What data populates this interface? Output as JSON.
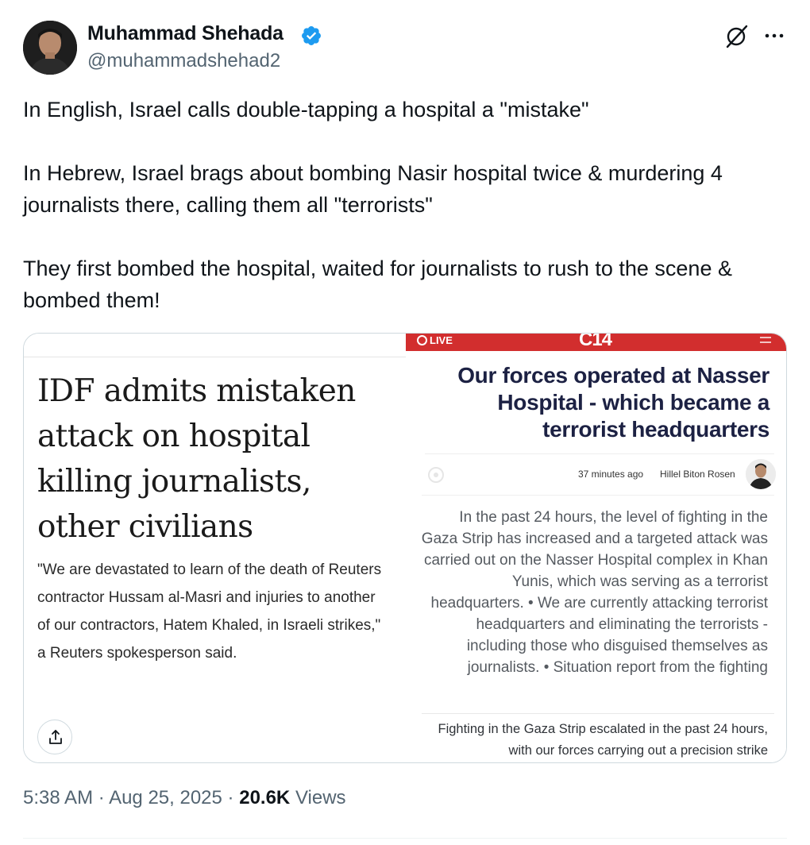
{
  "author": {
    "display_name": "Muhammad Shehada",
    "handle": "@muhammadshehad2",
    "verified": true,
    "avatar_icon": "person-portrait"
  },
  "header_actions": {
    "grok_icon": "grok-icon",
    "more_icon": "more-horizontal-icon"
  },
  "tweet": {
    "paragraphs": [
      "In English, Israel calls double-tapping a hospital a \"mistake\"",
      "In Hebrew, Israel brags about bombing Nasir hospital twice & murdering 4 journalists there, calling them all \"terrorists\"",
      "They first bombed the hospital, waited for journalists to rush to the scene & bombed them!"
    ]
  },
  "media": {
    "left": {
      "headline": "IDF admits mistaken attack on hospital killing journalists, other civilians",
      "quote": "\"We are devastated to learn of the death of Reuters contractor Hussam al-Masri and injuries to another of our contractors, Hatem Khaled, in Israeli strikes,\" a Reuters spokesperson said.",
      "share_icon": "share-icon"
    },
    "right": {
      "live_label": "LIVE",
      "logo": "C14",
      "headline": "Our forces operated at Nasser Hospital - which became a terrorist headquarters",
      "time_ago": "37 minutes ago",
      "author": "Hillel Biton Rosen",
      "body": "In the past 24 hours, the level of fighting in the Gaza Strip has increased and a targeted attack was carried out on the Nasser Hospital complex in Khan Yunis, which was serving as a terrorist headquarters. • We are currently attacking terrorist headquarters and eliminating the terrorists - including those who disguised themselves as journalists. • Situation report from the fighting",
      "body_2": "Fighting in the Gaza Strip escalated in the past 24 hours, with our forces carrying out a precision strike",
      "accent_color": "#d22e2e"
    }
  },
  "meta": {
    "time": "5:38 AM",
    "separator": "·",
    "date": "Aug 25, 2025",
    "views_count": "20.6K",
    "views_label": "Views"
  },
  "colors": {
    "verified_blue": "#1d9bf0",
    "secondary_text": "#536471",
    "headline_navy": "#1c2143"
  }
}
